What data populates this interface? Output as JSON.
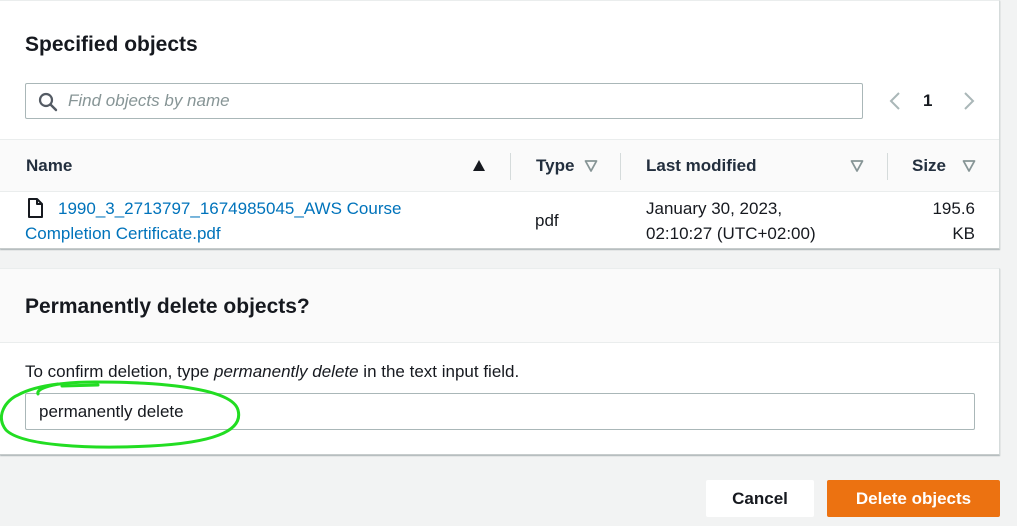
{
  "objects_panel": {
    "title": "Specified objects",
    "search": {
      "placeholder": "Find objects by name",
      "value": ""
    },
    "pagination": {
      "current_page": "1"
    },
    "table": {
      "columns": [
        {
          "label": "Name",
          "sort": "ascending"
        },
        {
          "label": "Type",
          "sort": "none"
        },
        {
          "label": "Last modified",
          "sort": "none"
        },
        {
          "label": "Size",
          "sort": "none"
        }
      ],
      "rows": [
        {
          "name": "1990_3_2713797_1674985045_AWS Course Completion Certificate.pdf",
          "type": "pdf",
          "last_modified_date": "January 30, 2023,",
          "last_modified_time": "02:10:27 (UTC+02:00)",
          "size_value": "195.6",
          "size_unit": "KB"
        }
      ]
    }
  },
  "delete_panel": {
    "title": "Permanently delete objects?",
    "instruction_prefix": "To confirm deletion, type ",
    "instruction_keyword": "permanently delete",
    "instruction_suffix": " in the text input field.",
    "input_value": "permanently delete"
  },
  "actions": {
    "cancel_label": "Cancel",
    "delete_label": "Delete objects"
  },
  "colors": {
    "primary_button": "#ec7211",
    "link": "#0073bb",
    "annotation": "#22dd22"
  },
  "icons": [
    "search-icon",
    "chevron-left-icon",
    "chevron-right-icon",
    "sort-ascending-icon",
    "sort-icon",
    "file-icon"
  ]
}
